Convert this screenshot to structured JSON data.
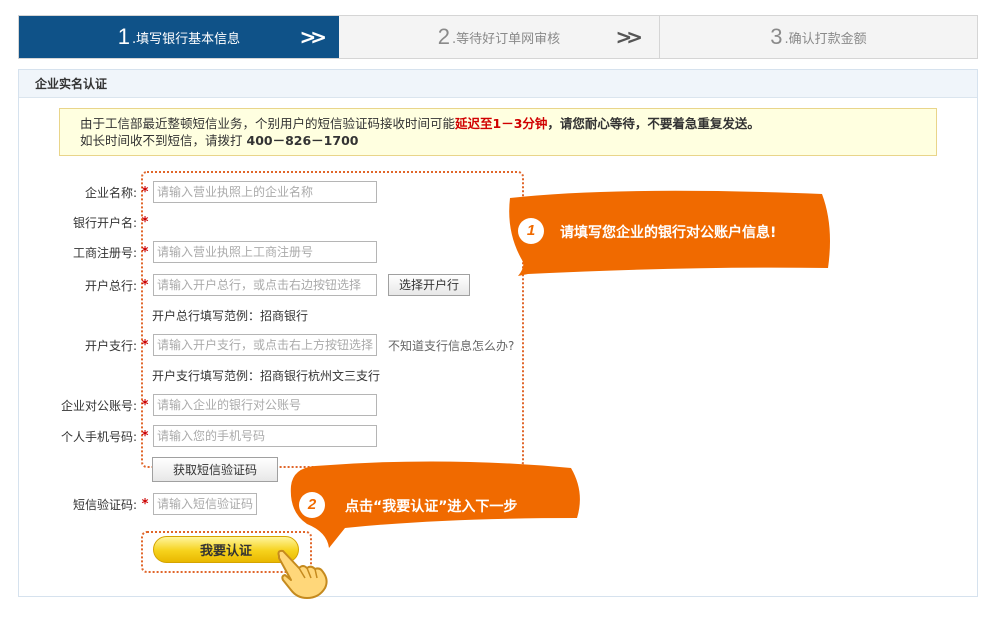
{
  "steps": [
    {
      "num": "1",
      "label": ".填写银行基本信息",
      "active": true
    },
    {
      "num": "2",
      "label": ".等待好订单网审核",
      "active": false
    },
    {
      "num": "3",
      "label": ".确认打款金额",
      "active": false
    }
  ],
  "panel": {
    "title": "企业实名认证"
  },
  "notice": {
    "line1_prefix": "由于工信部最近整顿短信业务，个别用户的短信验证码接收时间可能",
    "line1_red": "延迟至1－3分钟",
    "line1_suffix": "，请您耐心等待，不要着急重复发送。",
    "line2_prefix": "如长时间收不到短信，请拨打",
    "line2_phone": "400－826－1700"
  },
  "form": {
    "company_name": {
      "label": "企业名称:",
      "placeholder": "请输入营业执照上的企业名称"
    },
    "bank_account_name": {
      "label": "银行开户名:"
    },
    "reg_number": {
      "label": "工商注册号:",
      "placeholder": "请输入营业执照上工商注册号"
    },
    "head_bank": {
      "label": "开户总行:",
      "placeholder": "请输入开户总行，或点击右边按钮选择",
      "button": "选择开户行",
      "example": "开户总行填写范例：招商银行"
    },
    "branch_bank": {
      "label": "开户支行:",
      "placeholder": "请输入开户支行，或点击右上方按钮选择",
      "hint": "不知道支行信息怎么办?",
      "example": "开户支行填写范例：招商银行杭州文三支行"
    },
    "account_number": {
      "label": "企业对公账号:",
      "placeholder": "请输入企业的银行对公账号"
    },
    "mobile": {
      "label": "个人手机号码:",
      "placeholder": "请输入您的手机号码"
    },
    "sms_button": "获取短信验证码",
    "sms_code": {
      "label": "短信验证码:",
      "placeholder": "请输入短信验证码"
    },
    "submit": "我要认证",
    "required_mark": "*"
  },
  "callouts": [
    {
      "num": "1",
      "text": "请填写您企业的银行对公账户信息!"
    },
    {
      "num": "2",
      "text": "点击“我要认证”进入下一步"
    }
  ],
  "colors": {
    "step_active": "#0f5288",
    "callout": "#f06a00",
    "required": "#cc0000",
    "notice_bg": "#ffffe0"
  }
}
